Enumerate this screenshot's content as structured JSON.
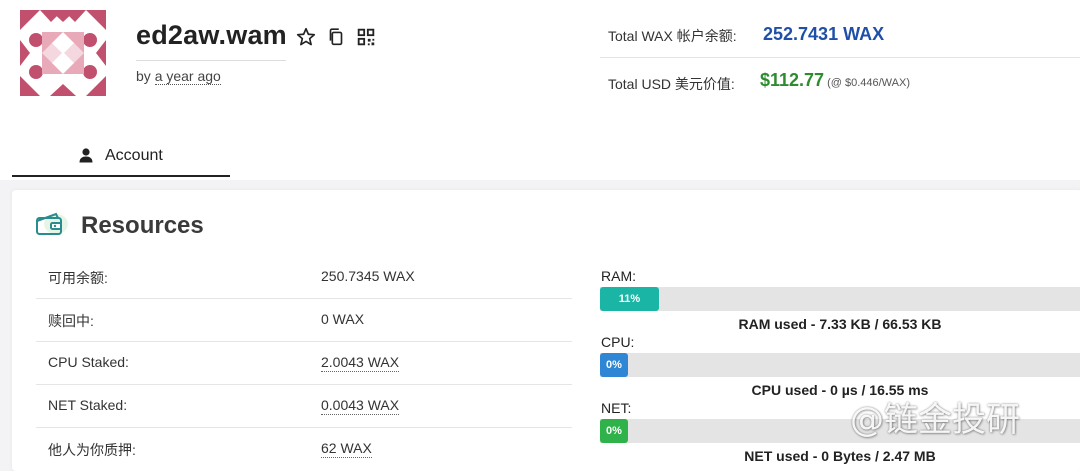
{
  "account": {
    "name": "ed2aw.wam",
    "created_prefix": "by",
    "created_ago": "a year ago",
    "icons": [
      "star-icon",
      "copy-icon",
      "qr-code-icon"
    ]
  },
  "totals": {
    "wax_label": "Total WAX 帐户余额:",
    "wax_value": "252.7431 WAX",
    "usd_label": "Total USD 美元价值:",
    "usd_value": "$112.77",
    "usd_rate": "(@ $0.446/WAX)"
  },
  "tabs": [
    {
      "label": "Account",
      "icon": "user-icon",
      "active": true
    }
  ],
  "resources": {
    "title": "Resources",
    "icon": "wallet-icon",
    "rows": [
      {
        "key": "可用余额:",
        "value": "250.7345 WAX"
      },
      {
        "key": "赎回中:",
        "value": "0 WAX"
      },
      {
        "key": "CPU Staked:",
        "value": "2.0043 WAX"
      },
      {
        "key": "NET Staked:",
        "value": "0.0043 WAX"
      },
      {
        "key": "他人为你质押:",
        "value": "62 WAX"
      }
    ],
    "meters": [
      {
        "label": "RAM:",
        "percent": 11,
        "percent_text": "11%",
        "color": "#1ab5a5",
        "caption": "RAM used - 7.33 KB / 66.53 KB"
      },
      {
        "label": "CPU:",
        "percent": 0,
        "percent_text": "0%",
        "color": "#2e86d4",
        "caption": "CPU used - 0 µs / 16.55 ms"
      },
      {
        "label": "NET:",
        "percent": 0,
        "percent_text": "0%",
        "color": "#2fb24a",
        "caption": "NET used - 0 Bytes / 2.47 MB"
      }
    ]
  },
  "watermark": "@链金投研"
}
